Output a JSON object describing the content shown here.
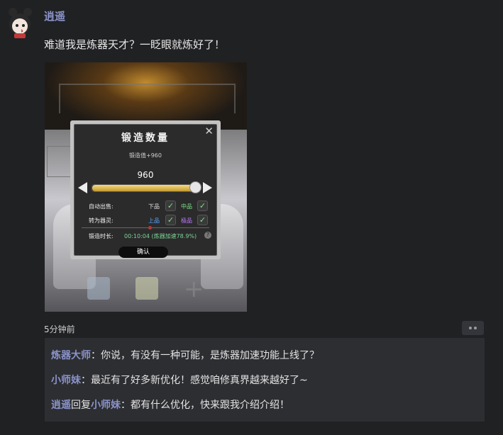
{
  "post": {
    "username": "逍遥",
    "text": "难道我是炼器天才？一眨眼就炼好了！",
    "timestamp": "5分钟前"
  },
  "screenshot": {
    "dialog": {
      "title": "锻造数量",
      "subtitle": "锻造值+960",
      "value": "960",
      "slider_fraction": 0.98,
      "auto_sell_label": "自动出售:",
      "auto_sell_options": [
        "下品",
        "中品"
      ],
      "convert_label": "转为器灵:",
      "convert_options": [
        "上品",
        "极品"
      ],
      "duration_label": "锻造时长:",
      "duration_value": "00:10:04 (炼器加速78.9%)",
      "help": "?",
      "close": "✕",
      "confirm_label": "确认",
      "check": "✓"
    },
    "colors": {
      "low": "#e0e0e0",
      "mid": "#7fe08a",
      "high": "#5aa6ff",
      "top": "#c07bff"
    }
  },
  "comments": [
    {
      "name": "炼器大师",
      "text": "：你说，有没有一种可能，是炼器加速功能上线了？"
    },
    {
      "name": "小师妹",
      "text": "：最近有了好多新优化！感觉咱修真界越来越好了~"
    },
    {
      "name": "逍遥",
      "reply_word": "回复",
      "reply_to": "小师妹",
      "text": "：都有什么优化，快来跟我介绍介绍！"
    }
  ],
  "icons": {
    "avatar": "avatar-icon",
    "more": "more-icon"
  }
}
